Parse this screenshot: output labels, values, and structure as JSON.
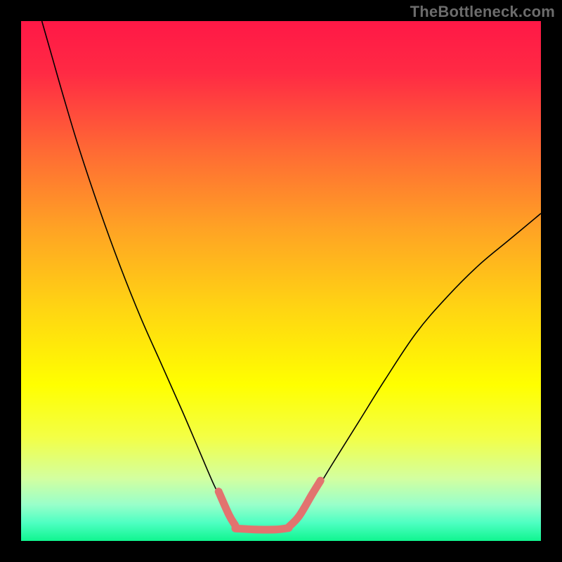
{
  "watermark": {
    "text": "TheBottleneck.com"
  },
  "chart_data": {
    "type": "line",
    "title": "",
    "xlabel": "",
    "ylabel": "",
    "xlim": [
      0,
      100
    ],
    "ylim": [
      0,
      100
    ],
    "grid": false,
    "legend": false,
    "gradient_stops": [
      {
        "offset": 0.0,
        "color": "#ff1846"
      },
      {
        "offset": 0.1,
        "color": "#ff2a44"
      },
      {
        "offset": 0.25,
        "color": "#ff6a34"
      },
      {
        "offset": 0.4,
        "color": "#ffa324"
      },
      {
        "offset": 0.55,
        "color": "#ffd413"
      },
      {
        "offset": 0.7,
        "color": "#ffff00"
      },
      {
        "offset": 0.8,
        "color": "#f3ff45"
      },
      {
        "offset": 0.88,
        "color": "#d3ffa0"
      },
      {
        "offset": 0.93,
        "color": "#99ffca"
      },
      {
        "offset": 0.965,
        "color": "#4effc2"
      },
      {
        "offset": 1.0,
        "color": "#10f58f"
      }
    ],
    "series": [
      {
        "name": "curve",
        "color": "#000000",
        "stroke_width": 1.6,
        "points": [
          {
            "x": 4,
            "y": 100
          },
          {
            "x": 6,
            "y": 93
          },
          {
            "x": 8,
            "y": 86
          },
          {
            "x": 11,
            "y": 76
          },
          {
            "x": 15,
            "y": 64
          },
          {
            "x": 19,
            "y": 53
          },
          {
            "x": 23,
            "y": 43
          },
          {
            "x": 27,
            "y": 34
          },
          {
            "x": 31,
            "y": 25
          },
          {
            "x": 34,
            "y": 18
          },
          {
            "x": 37,
            "y": 11
          },
          {
            "x": 39,
            "y": 7
          },
          {
            "x": 41,
            "y": 3.5
          },
          {
            "x": 43,
            "y": 2.3
          },
          {
            "x": 45,
            "y": 2.0
          },
          {
            "x": 47,
            "y": 2.0
          },
          {
            "x": 49,
            "y": 2.1
          },
          {
            "x": 51,
            "y": 2.6
          },
          {
            "x": 53,
            "y": 4.2
          },
          {
            "x": 56,
            "y": 8.5
          },
          {
            "x": 60,
            "y": 15
          },
          {
            "x": 65,
            "y": 23
          },
          {
            "x": 70,
            "y": 31
          },
          {
            "x": 76,
            "y": 40
          },
          {
            "x": 82,
            "y": 47
          },
          {
            "x": 88,
            "y": 53
          },
          {
            "x": 94,
            "y": 58
          },
          {
            "x": 100,
            "y": 63
          }
        ]
      },
      {
        "name": "highlight-left",
        "color": "#e2736f",
        "stroke_width": 11,
        "linecap": "round",
        "points": [
          {
            "x": 38.0,
            "y": 9.5
          },
          {
            "x": 40.0,
            "y": 5.0
          },
          {
            "x": 41.2,
            "y": 3.0
          }
        ]
      },
      {
        "name": "highlight-bottom",
        "color": "#e2736f",
        "stroke_width": 11,
        "linecap": "round",
        "points": [
          {
            "x": 41.2,
            "y": 2.4
          },
          {
            "x": 45.0,
            "y": 2.2
          },
          {
            "x": 49.0,
            "y": 2.2
          },
          {
            "x": 51.5,
            "y": 2.5
          }
        ]
      },
      {
        "name": "highlight-right",
        "color": "#e2736f",
        "stroke_width": 11,
        "linecap": "round",
        "points": [
          {
            "x": 51.5,
            "y": 2.7
          },
          {
            "x": 53.5,
            "y": 4.8
          },
          {
            "x": 56.0,
            "y": 9.0
          },
          {
            "x": 57.6,
            "y": 11.6
          }
        ]
      }
    ]
  }
}
